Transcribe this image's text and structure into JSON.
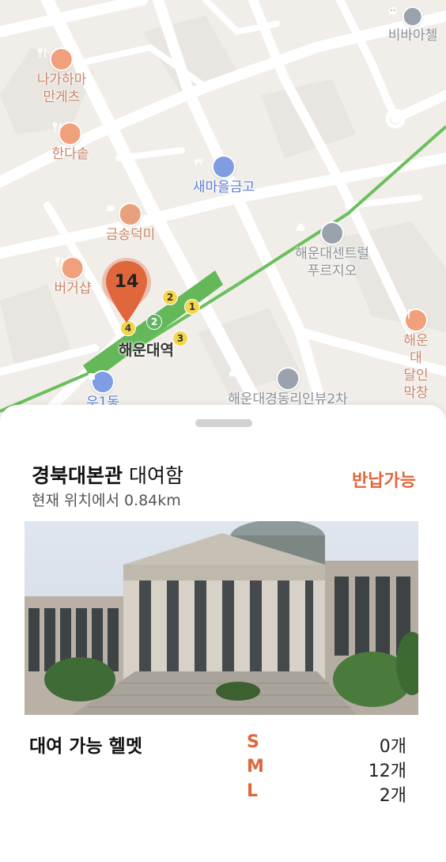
{
  "map": {
    "pois": [
      {
        "name": "비바아첼",
        "icon": "face-icon"
      },
      {
        "name": "나가하마\n만게츠",
        "icon": "food-icon"
      },
      {
        "name": "한다솥",
        "icon": "food-icon"
      },
      {
        "name": "새마을금고",
        "icon": "bank-icon"
      },
      {
        "name": "금송덕미",
        "icon": "cafe-icon"
      },
      {
        "name": "해운대센트럴\n푸르지오",
        "icon": "building-icon"
      },
      {
        "name": "버거샵",
        "icon": "food-icon"
      },
      {
        "name": "해운대\n달인막창",
        "icon": "food-icon"
      },
      {
        "name": "우1동",
        "icon": "building-icon"
      },
      {
        "name": "해운대경동리인뷰2차",
        "icon": "building-icon"
      }
    ],
    "station": "해운대역",
    "exits": [
      "2",
      "1",
      "2",
      "4",
      "3"
    ],
    "cluster_count": "14",
    "colors": {
      "subway_line": "#6bbf5c",
      "pin": "#e0663c",
      "background": "#f1eee9"
    }
  },
  "sheet": {
    "station_name": "경북대본관",
    "station_suffix": "대여함",
    "distance": "현재 위치에서 0.84km",
    "status": "반납가능",
    "helmet_title": "대여 가능 헬멧",
    "sizes": [
      {
        "label": "S",
        "count": "0개"
      },
      {
        "label": "M",
        "count": "12개"
      },
      {
        "label": "L",
        "count": "2개"
      }
    ],
    "accent_color": "#e0663c"
  }
}
